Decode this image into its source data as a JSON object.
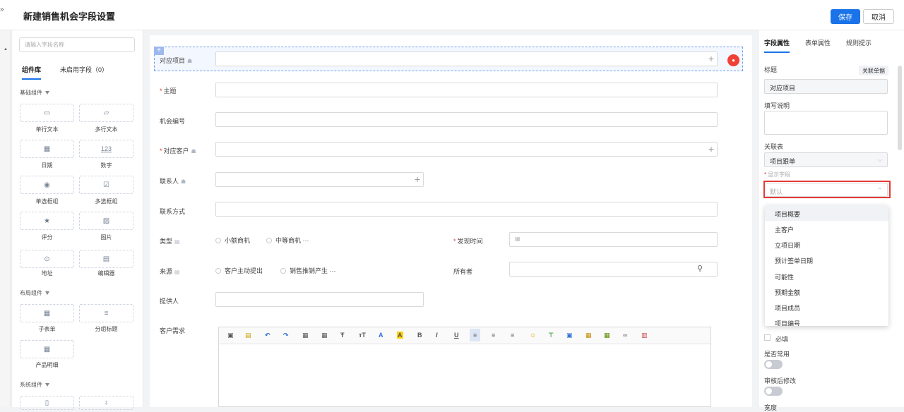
{
  "header": {
    "back_glyph": "»",
    "title": "新建销售机会字段设置",
    "save_label": "保存",
    "cancel_label": "取消"
  },
  "left": {
    "search_placeholder": "请输入字段名称",
    "tab_library": "组件库",
    "tab_unused": "未启用字段（0）",
    "groups": {
      "basic": "基础组件",
      "layout": "布局组件",
      "system": "系统组件"
    },
    "components": {
      "single_text": "单行文本",
      "multi_text": "多行文本",
      "date": "日期",
      "number": "数字",
      "radio": "单选框组",
      "checkbox": "多选框组",
      "rating": "评分",
      "image": "图片",
      "address": "地址",
      "editor": "编辑器",
      "subtable": "子表单",
      "group_title": "分组标题",
      "product_detail": "产品明细"
    },
    "number_glyph": "123"
  },
  "form": {
    "fields": {
      "project": "对应项目",
      "subject": "主题",
      "opp_no": "机会编号",
      "customer": "对应客户",
      "contact": "联系人",
      "contact_method": "联系方式",
      "type": "类型",
      "found_time": "发现时间",
      "source": "来源",
      "owner": "所有者",
      "provider": "提供人",
      "customer_needs": "客户需求"
    },
    "type_options": [
      "小额商机",
      "中等商机 ···"
    ],
    "source_options": [
      "客户主动提出",
      "销售推销产生 ···"
    ],
    "required_mark": "*"
  },
  "right": {
    "tabs": [
      "字段属性",
      "表单属性",
      "规则提示"
    ],
    "title_label": "标题",
    "relate_btn": "关联单据",
    "title_value": "对应项目",
    "desc_label": "填写说明",
    "related_table_label": "关联表",
    "related_table_value": "项目跟单",
    "display_field_label": "显示字段",
    "display_field_placeholder": "默认",
    "options": [
      "项目概要",
      "主客户",
      "立项日期",
      "预计签单日期",
      "可能性",
      "预期金额",
      "项目成员",
      "项目编号"
    ],
    "required_label": "必填",
    "common_label": "是否常用",
    "edit_after_audit_label": "审核后修改",
    "width_label": "宽度"
  }
}
